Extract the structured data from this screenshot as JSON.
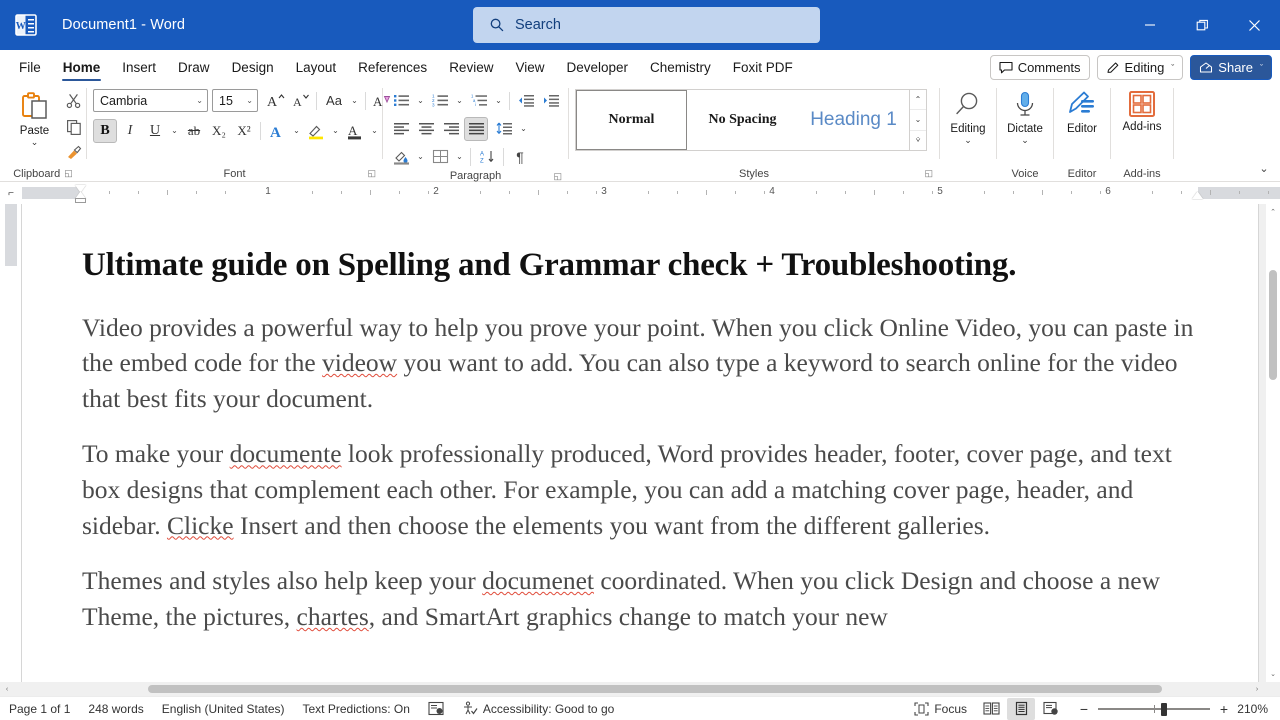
{
  "titlebar": {
    "app_icon": "word-logo-icon",
    "document_title": "Document1  -  Word",
    "search_placeholder": "Search",
    "search_icon": "search-icon",
    "minimize_icon": "minimize-icon",
    "restore_icon": "restore-icon",
    "close_icon": "close-icon"
  },
  "tabs": [
    {
      "label": "File",
      "active": false
    },
    {
      "label": "Home",
      "active": true
    },
    {
      "label": "Insert",
      "active": false
    },
    {
      "label": "Draw",
      "active": false
    },
    {
      "label": "Design",
      "active": false
    },
    {
      "label": "Layout",
      "active": false
    },
    {
      "label": "References",
      "active": false
    },
    {
      "label": "Review",
      "active": false
    },
    {
      "label": "View",
      "active": false
    },
    {
      "label": "Developer",
      "active": false
    },
    {
      "label": "Chemistry",
      "active": false
    },
    {
      "label": "Foxit PDF",
      "active": false
    }
  ],
  "tabbar_right": {
    "comments_label": "Comments",
    "comments_icon": "comment-bubble-icon",
    "editing_label": "Editing",
    "editing_icon": "pencil-icon",
    "share_label": "Share",
    "share_icon": "share-icon",
    "chevron": "ˇ"
  },
  "ribbon": {
    "clipboard": {
      "group_label": "Clipboard",
      "paste_label": "Paste",
      "paste_icon": "clipboard-paste-icon",
      "cut_icon": "scissors-icon",
      "copy_icon": "copy-icon",
      "format_painter_icon": "format-painter-icon",
      "dialog_launcher_icon": "dialog-launcher-icon"
    },
    "font": {
      "group_label": "Font",
      "font_family_value": "Cambria",
      "font_size_value": "15",
      "grow_font_icon": "grow-font-icon",
      "shrink_font_icon": "shrink-font-icon",
      "change_case_label": "Aa",
      "change_case_icon": "change-case-icon",
      "clear_formatting_icon": "clear-formatting-icon",
      "bold_label": "B",
      "italic_label": "I",
      "underline_label": "U",
      "strikethrough_label": "ab",
      "subscript_label": "X₂",
      "superscript_label": "X²",
      "text_effects_icon": "text-effects-icon",
      "highlight_icon": "text-highlight-icon",
      "font_color_icon": "font-color-icon",
      "dialog_launcher_icon": "dialog-launcher-icon",
      "bold_active": true
    },
    "paragraph": {
      "group_label": "Paragraph",
      "bullets_icon": "bullets-icon",
      "numbering_icon": "numbering-icon",
      "multilevel_icon": "multilevel-list-icon",
      "decrease_indent_icon": "decrease-indent-icon",
      "increase_indent_icon": "increase-indent-icon",
      "align_left_icon": "align-left-icon",
      "align_center_icon": "align-center-icon",
      "align_right_icon": "align-right-icon",
      "justify_icon": "justify-icon",
      "line_spacing_icon": "line-spacing-icon",
      "shading_icon": "shading-icon",
      "borders_icon": "borders-icon",
      "sort_icon": "sort-icon",
      "show_marks_label": "¶",
      "show_marks_icon": "pilcrow-icon",
      "dialog_launcher_icon": "dialog-launcher-icon",
      "justify_active": true
    },
    "styles": {
      "group_label": "Styles",
      "items": [
        {
          "label": "Normal",
          "selected": true,
          "color": "#1a1a1a"
        },
        {
          "label": "No Spacing",
          "selected": false,
          "color": "#1a1a1a"
        },
        {
          "label": "Heading 1",
          "selected": false,
          "color": "#5a8ac6"
        }
      ],
      "scroll_up_icon": "chevron-up-icon",
      "scroll_down_icon": "chevron-down-icon",
      "more_icon": "more-styles-icon",
      "dialog_launcher_icon": "dialog-launcher-icon"
    },
    "editing": {
      "group_label": "",
      "button_label": "Editing",
      "icon": "magnifier-icon"
    },
    "voice": {
      "group_label": "Voice",
      "button_label": "Dictate",
      "icon": "microphone-icon"
    },
    "editor_group": {
      "group_label": "Editor",
      "button_label": "Editor",
      "icon": "editor-pen-icon"
    },
    "addins": {
      "group_label": "Add-ins",
      "button_label": "Add-ins",
      "icon": "addins-grid-icon"
    },
    "collapse_icon": "collapse-ribbon-icon"
  },
  "ruler": {
    "corner_icon": "tab-stop-icon",
    "numbers": [
      "1",
      "2",
      "3",
      "4",
      "5",
      "6"
    ],
    "left_indent_marker": "indent-marker",
    "right_indent_marker": "right-indent-marker"
  },
  "document": {
    "heading": "Ultimate guide on Spelling and Grammar check + Troubleshooting.",
    "paragraphs": [
      {
        "runs": [
          {
            "text": "Video provides a powerful way to help you prove your point. When you click Online Video, you can paste in the embed code for the ",
            "misspelled": false
          },
          {
            "text": "videow",
            "misspelled": true
          },
          {
            "text": " you want to add. You can also type a keyword to search online for the video that best fits your document.",
            "misspelled": false
          }
        ]
      },
      {
        "runs": [
          {
            "text": "To make your ",
            "misspelled": false
          },
          {
            "text": "documente",
            "misspelled": true
          },
          {
            "text": " look professionally produced, Word provides header, footer, cover page, and text box designs that complement each other. For example, you can add a matching cover page, header, and sidebar. ",
            "misspelled": false
          },
          {
            "text": "Clicke",
            "misspelled": true
          },
          {
            "text": " Insert and then choose the elements you want from the different galleries.",
            "misspelled": false
          }
        ]
      },
      {
        "runs": [
          {
            "text": "Themes and styles also help keep your ",
            "misspelled": false
          },
          {
            "text": "documenet",
            "misspelled": true
          },
          {
            "text": " coordinated. When you click Design and choose a new Theme, the pictures, ",
            "misspelled": false
          },
          {
            "text": "chartes",
            "misspelled": true
          },
          {
            "text": ", and SmartArt graphics change to match your new",
            "misspelled": false
          }
        ]
      }
    ]
  },
  "statusbar": {
    "page_label": "Page 1 of 1",
    "word_count": "248 words",
    "language": "English (United States)",
    "text_predictions": "Text Predictions: On",
    "proofing_icon": "proofing-errors-icon",
    "accessibility_icon": "accessibility-icon",
    "accessibility_label": "Accessibility: Good to go",
    "focus_label": "Focus",
    "focus_icon": "focus-mode-icon",
    "read_mode_icon": "read-mode-icon",
    "print_layout_icon": "print-layout-icon",
    "web_layout_icon": "web-layout-icon",
    "zoom_out_label": "−",
    "zoom_in_label": "+",
    "zoom_value": "210%"
  },
  "colors": {
    "accent": "#185ABD",
    "ribbon_accent": "#2B579A",
    "spell_error": "#e04b3a",
    "search_bg": "#C2D5EF",
    "doc_text": "#4a4a4a"
  }
}
